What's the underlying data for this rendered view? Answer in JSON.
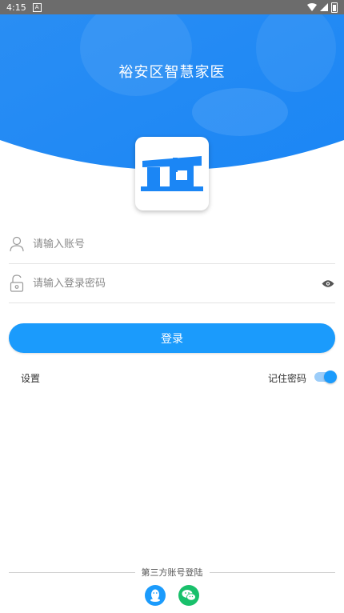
{
  "status_bar": {
    "time": "4:15",
    "notification_icon": "A"
  },
  "header": {
    "title": "裕安区智慧家医"
  },
  "form": {
    "account_placeholder": "请输入账号",
    "password_placeholder": "请输入登录密码",
    "login_label": "登录"
  },
  "options": {
    "settings_label": "设置",
    "remember_label": "记住密码",
    "remember_checked": true
  },
  "footer": {
    "third_party_label": "第三方账号登陆"
  },
  "colors": {
    "brand_blue": "#1b9bfc",
    "wechat_green": "#19c06b"
  }
}
